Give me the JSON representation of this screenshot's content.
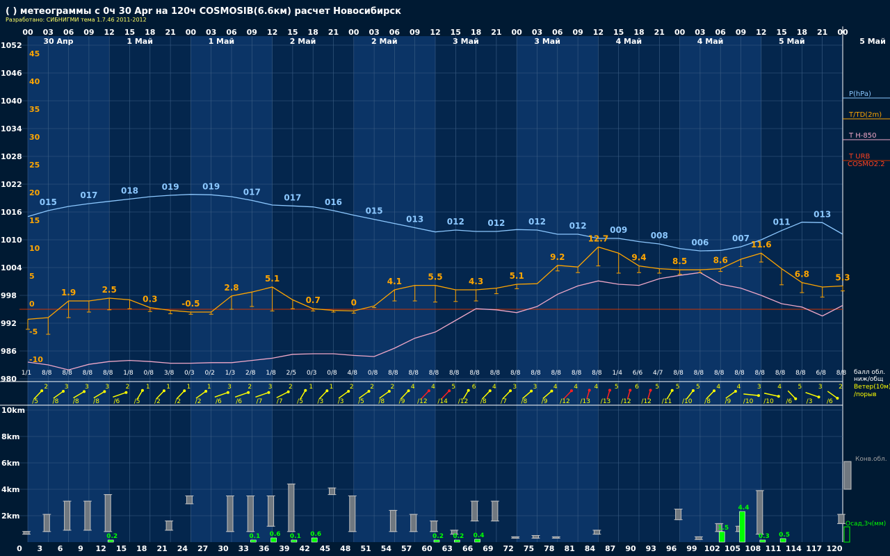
{
  "header": {
    "title": "( ) метеограммы с  0ч 30 Apr на 120ч COSMOSIB(6.6км) расчет Новосибирск",
    "subtitle": "Разработано: СИБНИГМИ тема 1.7.46 2011-2012"
  },
  "colors": {
    "background": "#001a33",
    "band_light": "#0b3466",
    "band_dark": "#04264d",
    "grid": "#3d5f86",
    "pressure": "#8cc8ff",
    "temperature": "#ffa500",
    "t850": "#f0a8c8",
    "zero_line": "#cc3300",
    "wind": "#ffff00",
    "wind_strong": "#ff2020",
    "precip": "#00ff00",
    "cloud": "#a0a0a0",
    "text_white": "#ffffff"
  },
  "legend": {
    "p": "P(hPa)",
    "t": "T/TD(2m)",
    "t850": "T H-850",
    "turb": "T URB",
    "model": "COSMO2.2",
    "cloud_label": "балл обл.\nниж/общ",
    "wind_label": "Ветер(10м)\n/порыв",
    "conv_label": "Конв.обл.",
    "precip_label": "Осад,3ч(мм)"
  },
  "chart_data": {
    "type": "line",
    "top_hours": [
      "00",
      "03",
      "06",
      "09",
      "12",
      "15",
      "18",
      "21",
      "00",
      "03",
      "06",
      "09",
      "12",
      "15",
      "18",
      "21",
      "00",
      "03",
      "06",
      "09",
      "12",
      "15",
      "18",
      "21",
      "00",
      "03",
      "06",
      "09",
      "12",
      "15",
      "18",
      "21",
      "00",
      "03",
      "06",
      "09",
      "12",
      "15",
      "18",
      "21",
      "00"
    ],
    "day_labels": [
      "30 Апр",
      "1 Май",
      "1 Май",
      "2 Май",
      "2 Май",
      "3 Май",
      "3 Май",
      "4 Май",
      "4 Май",
      "5 Май",
      "5 Май"
    ],
    "pressure_ticks": [
      "1052",
      "1046",
      "1040",
      "1034",
      "1028",
      "1022",
      "1016",
      "1010",
      "1004",
      "998",
      "992",
      "986",
      "980"
    ],
    "temp_ticks": [
      "45",
      "40",
      "35",
      "30",
      "25",
      "20",
      "15",
      "10",
      "5",
      "0",
      "-5",
      "-10"
    ],
    "height_ticks": [
      "10km",
      "8km",
      "6km",
      "4km",
      "2km"
    ],
    "bottom_hours": [
      "0",
      "3",
      "6",
      "9",
      "12",
      "15",
      "18",
      "21",
      "24",
      "27",
      "30",
      "33",
      "36",
      "39",
      "42",
      "45",
      "48",
      "51",
      "54",
      "57",
      "60",
      "63",
      "66",
      "69",
      "72",
      "75",
      "78",
      "81",
      "84",
      "87",
      "90",
      "93",
      "96",
      "99",
      "102",
      "105",
      "108",
      "111",
      "114",
      "117",
      "120"
    ],
    "pressure": {
      "name": "P(hPa)",
      "values": [
        1015,
        1016.3,
        1017.2,
        1017.8,
        1018.3,
        1018.8,
        1019.3,
        1019.6,
        1019.8,
        1019.7,
        1019.3,
        1018.5,
        1017.5,
        1017.3,
        1017.1,
        1016.3,
        1015.3,
        1014.4,
        1013.5,
        1012.6,
        1011.7,
        1012.1,
        1011.8,
        1011.8,
        1012.2,
        1012.1,
        1011.2,
        1011.2,
        1010.3,
        1010.3,
        1009.6,
        1009.1,
        1008.1,
        1007.6,
        1007.7,
        1008.5,
        1010.0,
        1012.0,
        1013.8,
        1013.7,
        1011.2
      ],
      "labels": [
        {
          "i": 1,
          "text": "015"
        },
        {
          "i": 3,
          "text": "017"
        },
        {
          "i": 5,
          "text": "018"
        },
        {
          "i": 7,
          "text": "019"
        },
        {
          "i": 9,
          "text": "019"
        },
        {
          "i": 11,
          "text": "017"
        },
        {
          "i": 13,
          "text": "017"
        },
        {
          "i": 15,
          "text": "016"
        },
        {
          "i": 17,
          "text": "015"
        },
        {
          "i": 19,
          "text": "013"
        },
        {
          "i": 21,
          "text": "012"
        },
        {
          "i": 23,
          "text": "012"
        },
        {
          "i": 25,
          "text": "012"
        },
        {
          "i": 27,
          "text": "012"
        },
        {
          "i": 29,
          "text": "009"
        },
        {
          "i": 31,
          "text": "008"
        },
        {
          "i": 33,
          "text": "006"
        },
        {
          "i": 35,
          "text": "007"
        },
        {
          "i": 37,
          "text": "011"
        },
        {
          "i": 39,
          "text": "013"
        }
      ]
    },
    "temperature": {
      "name": "T/TD(2m)",
      "values": [
        -1.8,
        -1.5,
        1.5,
        1.5,
        2.0,
        1.7,
        0.3,
        -0.2,
        -0.5,
        -0.5,
        2.4,
        3.1,
        4.0,
        1.7,
        0.1,
        -0.2,
        -0.3,
        0.6,
        3.5,
        4.3,
        4.3,
        3.5,
        3.5,
        3.8,
        4.5,
        4.6,
        7.9,
        7.6,
        11.2,
        10.1,
        7.8,
        7.3,
        7.1,
        7.1,
        7.3,
        9.0,
        10.1,
        7.3,
        4.8,
        4.0,
        4.2
      ],
      "labels": [
        {
          "i": 2,
          "text": "1.9"
        },
        {
          "i": 4,
          "text": "2.5"
        },
        {
          "i": 6,
          "text": "0.3"
        },
        {
          "i": 8,
          "text": "-0.5"
        },
        {
          "i": 10,
          "text": "2.8"
        },
        {
          "i": 12,
          "text": "5.1"
        },
        {
          "i": 14,
          "text": "0.7"
        },
        {
          "i": 16,
          "text": "0"
        },
        {
          "i": 18,
          "text": "4.1"
        },
        {
          "i": 20,
          "text": "5.5"
        },
        {
          "i": 22,
          "text": "4.3"
        },
        {
          "i": 24,
          "text": "5.1"
        },
        {
          "i": 26,
          "text": "9.2"
        },
        {
          "i": 28,
          "text": "12.7"
        },
        {
          "i": 30,
          "text": "9.4"
        },
        {
          "i": 32,
          "text": "8.5"
        },
        {
          "i": 34,
          "text": "8.6"
        },
        {
          "i": 36,
          "text": "11.6"
        },
        {
          "i": 38,
          "text": "6.8"
        },
        {
          "i": 40,
          "text": "5.3"
        }
      ]
    },
    "t850": {
      "name": "T H-850",
      "values": [
        -9.5,
        -10.0,
        -10.9,
        -9.9,
        -9.4,
        -9.2,
        -9.4,
        -9.7,
        -9.7,
        -9.6,
        -9.6,
        -9.2,
        -8.8,
        -8.1,
        -8.0,
        -8.0,
        -8.3,
        -8.5,
        -7.0,
        -5.2,
        -4.1,
        -2.0,
        0.1,
        -0.1,
        -0.6,
        0.5,
        2.7,
        4.2,
        5.1,
        4.5,
        4.3,
        5.5,
        6.1,
        6.6,
        4.5,
        3.8,
        2.5,
        1.0,
        0.4,
        -1.2,
        0.7
      ]
    },
    "zero_line": 0,
    "temp_error_bars": [
      1.8,
      3.0,
      3.0,
      2.0,
      2.1,
      1.6,
      0.7,
      0.6,
      0.4,
      0.4,
      2.4,
      2.6,
      4.3,
      1.6,
      0.4,
      0.3,
      0.4,
      0.3,
      2.0,
      2.8,
      3.0,
      2.1,
      2.0,
      1.0,
      0.8,
      0.0,
      1.0,
      1.0,
      3.4,
      3.6,
      1.2,
      0.8,
      0.8,
      0.5,
      0.5,
      1.3,
      1.6,
      2.9,
      1.8,
      1.8,
      0.9
    ],
    "cloud_cover": [
      "1/1",
      "8/8",
      "8/8",
      "8/8",
      "8/8",
      "1/8",
      "0/8",
      "3/8",
      "0/3",
      "0/2",
      "1/3",
      "2/8",
      "1/8",
      "2/5",
      "0/3",
      "0/8",
      "4/8",
      "0/8",
      "8/8",
      "8/8",
      "8/8",
      "8/8",
      "8/8",
      "8/8",
      "8/8",
      "8/8",
      "8/8",
      "8/8",
      "8/8",
      "1/4",
      "6/6",
      "4/7",
      "8/8",
      "8/8",
      "8/8",
      "8/8",
      "8/8",
      "8/8",
      "8/8",
      "6/8",
      "8/8"
    ],
    "wind_speed": [
      "2",
      "3",
      "3",
      "3",
      "2",
      "1",
      "1",
      "1",
      "1",
      "3",
      "2",
      "3",
      "2",
      "1",
      "1",
      "2",
      "2",
      "2",
      "4",
      "4",
      "5",
      "6",
      "4",
      "3",
      "3",
      "4",
      "4",
      "4",
      "5",
      "6",
      "5",
      "5",
      "5",
      "4",
      "4",
      "3",
      "4",
      "5",
      "3",
      "2",
      "1",
      "3"
    ],
    "wind_gust": [
      "/5",
      "/8",
      "/8",
      "/8",
      "/6",
      "/5",
      "/2",
      "/2",
      "/2",
      "/6",
      "/6",
      "/7",
      "/7",
      "/5",
      "/3",
      "/3",
      "/5",
      "/8",
      "/9",
      "/12",
      "/14",
      "/12",
      "/8",
      "/7",
      "/8",
      "/9",
      "/12",
      "/13",
      "/13",
      "/12",
      "/12",
      "/11",
      "/10",
      "/8",
      "/9",
      "/10",
      "/10",
      "/6",
      "/3",
      "/6"
    ],
    "wind_dir_deg": [
      30,
      40,
      45,
      45,
      60,
      20,
      30,
      30,
      40,
      60,
      60,
      60,
      50,
      20,
      30,
      40,
      40,
      40,
      30,
      30,
      30,
      20,
      30,
      30,
      35,
      35,
      30,
      10,
      10,
      10,
      10,
      20,
      25,
      30,
      40,
      100,
      110,
      150,
      120,
      140
    ],
    "wind_strong": [
      false,
      false,
      false,
      false,
      false,
      false,
      false,
      false,
      false,
      false,
      false,
      false,
      false,
      false,
      false,
      false,
      false,
      false,
      false,
      true,
      true,
      false,
      false,
      false,
      false,
      false,
      true,
      true,
      true,
      true,
      true,
      false,
      false,
      false,
      false,
      false,
      false,
      false,
      false,
      false
    ],
    "clouds_km": [
      [
        0.6,
        0.8
      ],
      [
        0.8,
        2.1
      ],
      [
        0.9,
        3.1
      ],
      [
        0.9,
        3.1
      ],
      [
        0.8,
        3.6
      ],
      [
        0,
        0
      ],
      [
        0,
        0
      ],
      [
        0.9,
        1.6
      ],
      [
        2.9,
        3.5
      ],
      [
        0,
        0
      ],
      [
        0.8,
        3.5
      ],
      [
        0.8,
        3.5
      ],
      [
        1.2,
        3.5
      ],
      [
        0.8,
        4.4
      ],
      [
        0,
        0
      ],
      [
        3.6,
        4.1
      ],
      [
        0.8,
        3.5
      ],
      [
        0,
        0
      ],
      [
        0.8,
        2.4
      ],
      [
        0.8,
        2.1
      ],
      [
        0.8,
        1.6
      ],
      [
        0.6,
        0.9
      ],
      [
        1.6,
        3.1
      ],
      [
        1.6,
        3.1
      ],
      [
        0.3,
        0.4
      ],
      [
        0.3,
        0.5
      ],
      [
        0.3,
        0.4
      ],
      [
        0,
        0
      ],
      [
        0.6,
        0.9
      ],
      [
        0,
        0
      ],
      [
        0,
        0
      ],
      [
        0,
        0
      ],
      [
        1.7,
        2.5
      ],
      [
        0.2,
        0.4
      ],
      [
        0.8,
        1.4
      ],
      [
        0.8,
        1.2
      ],
      [
        0.6,
        3.9
      ],
      [
        0,
        0
      ],
      [
        0,
        0
      ],
      [
        0,
        0
      ],
      [
        1.4,
        2.1
      ]
    ],
    "precip_mm": [
      0,
      0,
      0,
      0,
      0.2,
      0,
      0,
      0,
      0,
      0,
      0,
      0.1,
      0.6,
      0.1,
      0.6,
      0,
      0,
      0,
      0,
      0,
      0.2,
      0.2,
      0.4,
      0,
      0,
      0,
      0,
      0,
      0,
      0,
      0,
      0,
      0,
      0,
      1.5,
      4.4,
      0.3,
      0.5,
      0,
      0,
      0
    ],
    "ylim_pressure": [
      980,
      1052
    ],
    "ylim_temp": [
      -10,
      45
    ]
  }
}
